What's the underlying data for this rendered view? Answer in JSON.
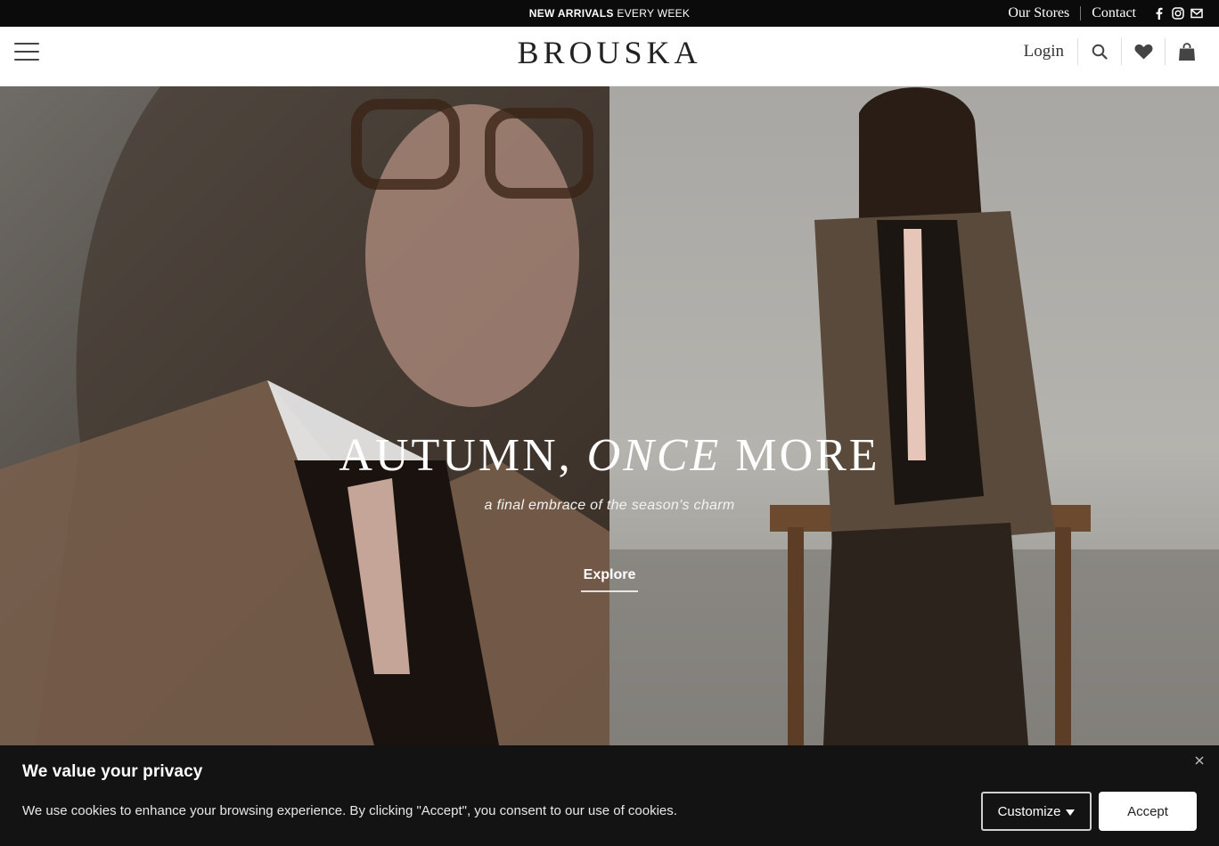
{
  "topbar": {
    "promo_bold": "NEW ARRIVALS",
    "promo_rest": " EVERY WEEK",
    "link_stores": "Our Stores",
    "link_contact": "Contact",
    "social_icons": [
      "facebook-icon",
      "instagram-icon",
      "mail-icon"
    ]
  },
  "header": {
    "logo": "BROUSKA",
    "login": "Login",
    "icons": [
      "menu-icon",
      "search-icon",
      "heart-icon",
      "bag-icon"
    ]
  },
  "hero": {
    "title_a": "AUTUMN, ",
    "title_em": "ONCE",
    "title_b": " MORE",
    "subtitle": "a final embrace of the season's charm",
    "button": "Explore"
  },
  "cookie": {
    "title": "We value your privacy",
    "text": "We use cookies to enhance your browsing experience. By clicking \"Accept\", you consent to our use of cookies.",
    "customize": "Customize",
    "accept": "Accept"
  },
  "colors": {
    "topbar_bg": "#0b0b0b",
    "cookie_bg": "#131313",
    "accent": "#ffffff"
  }
}
